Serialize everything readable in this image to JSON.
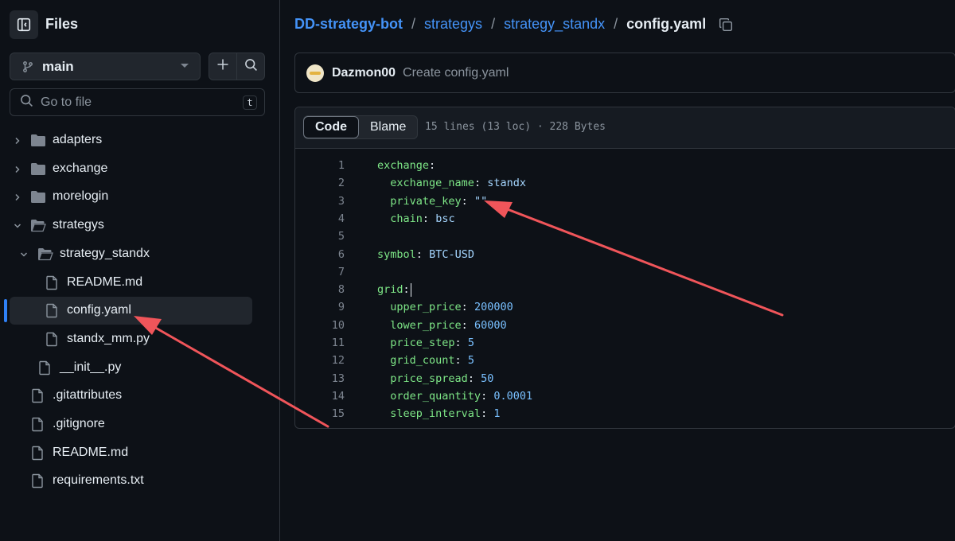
{
  "sidebar": {
    "title": "Files",
    "branch": "main",
    "search_placeholder": "Go to file",
    "search_shortcut": "t",
    "tree": [
      {
        "label": "adapters",
        "type": "folder",
        "depth": 0,
        "expanded": false
      },
      {
        "label": "exchange",
        "type": "folder",
        "depth": 0,
        "expanded": false
      },
      {
        "label": "morelogin",
        "type": "folder",
        "depth": 0,
        "expanded": false
      },
      {
        "label": "strategys",
        "type": "folder",
        "depth": 0,
        "expanded": true
      },
      {
        "label": "strategy_standx",
        "type": "folder",
        "depth": 1,
        "expanded": true
      },
      {
        "label": "README.md",
        "type": "file",
        "depth": 2
      },
      {
        "label": "config.yaml",
        "type": "file",
        "depth": 2,
        "selected": true
      },
      {
        "label": "standx_mm.py",
        "type": "file",
        "depth": 2
      },
      {
        "label": "__init__.py",
        "type": "file",
        "depth": 1
      },
      {
        "label": ".gitattributes",
        "type": "file",
        "depth": 0
      },
      {
        "label": ".gitignore",
        "type": "file",
        "depth": 0
      },
      {
        "label": "README.md",
        "type": "file",
        "depth": 0
      },
      {
        "label": "requirements.txt",
        "type": "file",
        "depth": 0
      }
    ]
  },
  "breadcrumb": {
    "repo": "DD-strategy-bot",
    "dirs": [
      "strategys",
      "strategy_standx"
    ],
    "separator": "/",
    "file": "config.yaml"
  },
  "commit": {
    "author": "Dazmon00",
    "message": "Create config.yaml"
  },
  "file": {
    "tabs": [
      "Code",
      "Blame"
    ],
    "active_tab": "Code",
    "meta": "15 lines (13 loc) · 228 Bytes",
    "lines": [
      {
        "num": "1",
        "indent": "",
        "key": "exchange",
        "value": "",
        "vtype": ""
      },
      {
        "num": "2",
        "indent": "  ",
        "key": "exchange_name",
        "value": "standx",
        "vtype": "str"
      },
      {
        "num": "3",
        "indent": "  ",
        "key": "private_key",
        "value": "\"\"",
        "vtype": "str"
      },
      {
        "num": "4",
        "indent": "  ",
        "key": "chain",
        "value": "bsc",
        "vtype": "str"
      },
      {
        "num": "5",
        "indent": "",
        "key": "",
        "value": "",
        "vtype": ""
      },
      {
        "num": "6",
        "indent": "",
        "key": "symbol",
        "value": "BTC-USD",
        "vtype": "str"
      },
      {
        "num": "7",
        "indent": "",
        "key": "",
        "value": "",
        "vtype": ""
      },
      {
        "num": "8",
        "indent": "",
        "key": "grid",
        "value": "",
        "vtype": "",
        "cursor": true
      },
      {
        "num": "9",
        "indent": "  ",
        "key": "upper_price",
        "value": "200000",
        "vtype": "num"
      },
      {
        "num": "10",
        "indent": "  ",
        "key": "lower_price",
        "value": "60000",
        "vtype": "num"
      },
      {
        "num": "11",
        "indent": "  ",
        "key": "price_step",
        "value": "5",
        "vtype": "num"
      },
      {
        "num": "12",
        "indent": "  ",
        "key": "grid_count",
        "value": "5",
        "vtype": "num"
      },
      {
        "num": "13",
        "indent": "  ",
        "key": "price_spread",
        "value": "50",
        "vtype": "num"
      },
      {
        "num": "14",
        "indent": "  ",
        "key": "order_quantity",
        "value": "0.0001",
        "vtype": "num"
      },
      {
        "num": "15",
        "indent": "  ",
        "key": "sleep_interval",
        "value": "1",
        "vtype": "num"
      }
    ]
  },
  "colors": {
    "background": "#0d1117",
    "accent_link": "#4493f8",
    "selection_bar": "#2f81f7",
    "annotation_arrow": "#f0555a",
    "yaml_key": "#7ee787",
    "yaml_value": "#a5d6ff",
    "yaml_number": "#79c0ff"
  },
  "icons": [
    "sidebar-collapse-icon",
    "git-branch-icon",
    "chevron-down-icon",
    "plus-icon",
    "search-icon",
    "folder-icon",
    "folder-open-icon",
    "file-icon",
    "chevron-right-icon",
    "copy-icon"
  ]
}
